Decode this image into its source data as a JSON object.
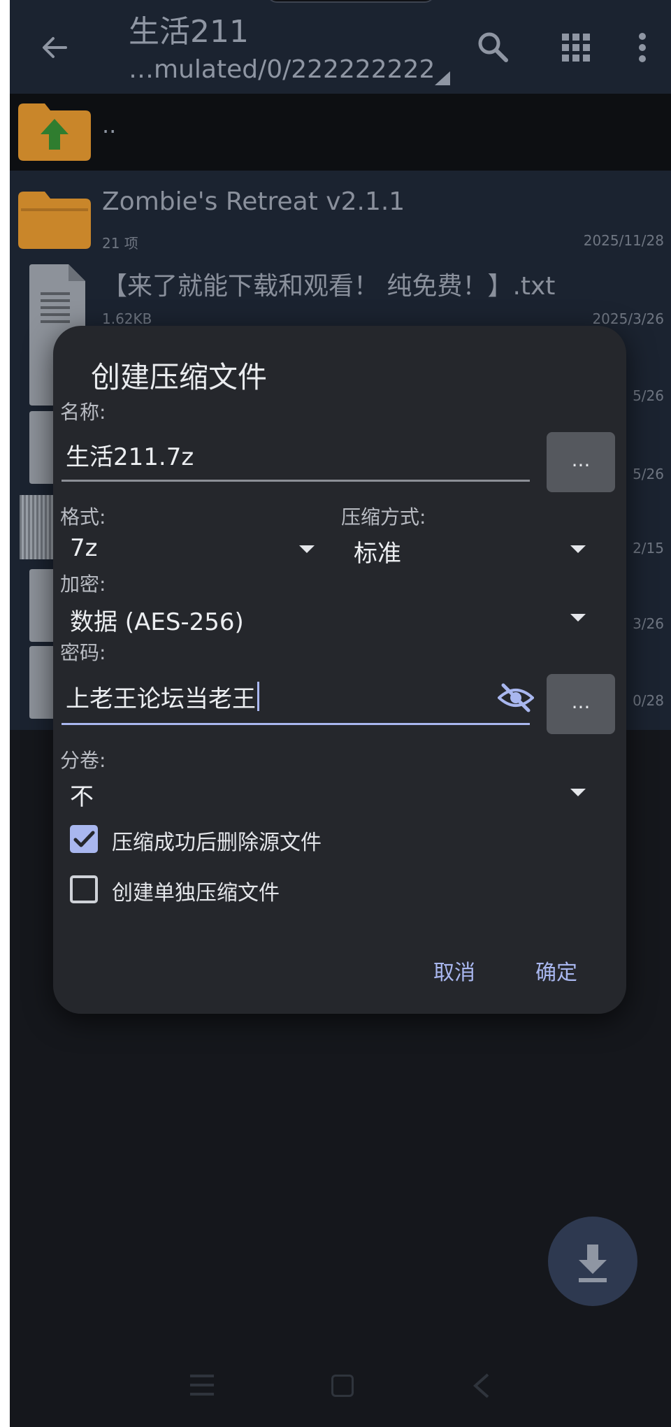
{
  "appbar": {
    "title": "生活211",
    "path": "…mulated/0/222222222",
    "icons": [
      "back-arrow-icon",
      "search-icon",
      "grid-view-icon",
      "more-vert-icon"
    ]
  },
  "file_list": {
    "parent_label": "..",
    "items": [
      {
        "name": "Zombie's Retreat v2.1.1",
        "meta": "21 项",
        "date": "2025/11/28",
        "icon": "folder-icon"
      },
      {
        "name": "【来了就能下载和观看！ 纯免费！】.txt",
        "meta": "1.62KB",
        "date": "2025/3/26",
        "icon": "text-file-icon"
      }
    ],
    "partial_dates": [
      "5/26",
      "5/26",
      "2/15",
      "3/26",
      "0/28"
    ]
  },
  "dialog": {
    "title": "创建压缩文件",
    "name_label": "名称:",
    "name_value": "生活211.7z",
    "browse_label": "...",
    "format_label": "格式:",
    "format_value": "7z",
    "method_label": "压缩方式:",
    "method_value": "标准",
    "encryption_label": "加密:",
    "encryption_value": "数据 (AES-256)",
    "password_label": "密码:",
    "password_value": "上老王论坛当老王",
    "password_browse_label": "...",
    "split_label": "分卷:",
    "split_value": "不",
    "delete_source_label": "压缩成功后删除源文件",
    "delete_source_checked": true,
    "separate_archive_label": "创建单独压缩文件",
    "separate_archive_checked": false,
    "cancel_label": "取消",
    "ok_label": "确定"
  },
  "colors": {
    "accent": "#a9b7ef",
    "dialog_bg": "#25272c",
    "appbar_bg": "#1b2330",
    "folder": "#c9862a"
  }
}
